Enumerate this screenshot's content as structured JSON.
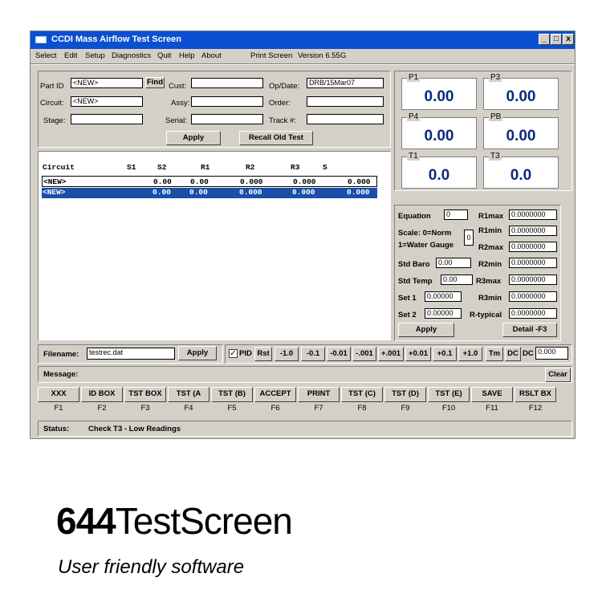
{
  "window": {
    "title": "CCDI Mass Airflow Test Screen",
    "controls": [
      "_",
      "□",
      "x"
    ]
  },
  "menu": [
    "Select",
    "Edit",
    "Setup",
    "Diagnostics",
    "Quit",
    "Help",
    "About",
    "Print Screen",
    "Version 6.55G"
  ],
  "form": {
    "part_id_label": "Part ID",
    "part_id_value": "<NEW>",
    "find_label": "Find",
    "cust_label": "Cust:",
    "cust_value": "",
    "opdate_label": "Op/Date:",
    "opdate_value": "DRB/15Mar07",
    "circuit_label": "Circuit:",
    "circuit_value": "<NEW>",
    "assy_label": "Assy:",
    "assy_value": "",
    "order_label": "Order:",
    "order_value": "",
    "stage_label": "Stage:",
    "stage_value": "",
    "serial_label": "Serial:",
    "serial_value": "",
    "track_label": "Track #:",
    "track_value": "",
    "apply_label": "Apply",
    "recall_label": "Recall Old Test"
  },
  "gauges": {
    "p1": {
      "label": "P1",
      "value": "0.00"
    },
    "p3": {
      "label": "P3",
      "value": "0.00"
    },
    "p4": {
      "label": "P4",
      "value": "0.00"
    },
    "pb": {
      "label": "PB",
      "value": "0.00"
    },
    "t1": {
      "label": "T1",
      "value": "0.0"
    },
    "t3": {
      "label": "T3",
      "value": "0.0"
    }
  },
  "table": {
    "headers": [
      "Circuit",
      "S1",
      "S2",
      "R1",
      "R2",
      "R3",
      "S"
    ],
    "rows": [
      [
        "<NEW>",
        "0.00",
        "0.00",
        "0.000",
        "0.000",
        "0.000"
      ],
      [
        "<NEW>",
        "0.00",
        "0.00",
        "0.000",
        "0.000",
        "0.000"
      ]
    ]
  },
  "settings": {
    "equation_label": "Equation",
    "equation_value": "0",
    "scale_label1": "Scale: 0=Norm",
    "scale_label2": "1=Water Gauge",
    "scale_value": "0",
    "stdbaro_label": "Std Baro",
    "stdbaro_value": "0.00",
    "stdtemp_label": "Std Temp",
    "stdtemp_value": "0.00",
    "set1_label": "Set 1",
    "set1_value": "0.00000",
    "set2_label": "Set 2",
    "set2_value": "0.00000",
    "r1max_label": "R1max",
    "r1max_value": "0.0000000",
    "r1min_label": "R1min",
    "r1min_value": "0.0000000",
    "r2max_label": "R2max",
    "r2max_value": "0.0000000",
    "r2min_label": "R2min",
    "r2min_value": "0.0000000",
    "r3max_label": "R3max",
    "r3max_value": "0.0000000",
    "r3min_label": "R3min",
    "r3min_value": "0.0000000",
    "rtyp_label": "R-typical",
    "rtyp_value": "0.0000000",
    "apply_label": "Apply",
    "detail_label": "Detail -F3"
  },
  "filename": {
    "label": "Filename:",
    "value": "testrec.dat",
    "apply_label": "Apply"
  },
  "pid": {
    "check_label": "PID",
    "checked": true,
    "rst_label": "Rst",
    "steps": [
      "-1.0",
      "-0.1",
      "-0.01",
      "-.001",
      "+.001",
      "+0.01",
      "+0.1",
      "+1.0"
    ],
    "tm_label": "Tm",
    "dc_label": "DC",
    "dc2_label": "DC",
    "dc_value": "0.000"
  },
  "message": {
    "label": "Message:",
    "value": "",
    "clear_label": "Clear"
  },
  "fkeys": [
    {
      "label": "XXX",
      "key": "F1"
    },
    {
      "label": "ID BOX",
      "key": "F2"
    },
    {
      "label": "TST BOX",
      "key": "F3"
    },
    {
      "label": "TST (A",
      "key": "F4"
    },
    {
      "label": "TST (B)",
      "key": "F5"
    },
    {
      "label": "ACCEPT",
      "key": "F6"
    },
    {
      "label": "PRINT",
      "key": "F7"
    },
    {
      "label": "TST (C)",
      "key": "F8"
    },
    {
      "label": "TST (D)",
      "key": "F9"
    },
    {
      "label": "TST (E)",
      "key": "F10"
    },
    {
      "label": "SAVE",
      "key": "F11"
    },
    {
      "label": "RSLT BX",
      "key": "F12"
    }
  ],
  "status": {
    "label": "Status:",
    "value": "Check T3 - Low Readings"
  },
  "caption": {
    "title_bold": "644",
    "title_rest": "TestScreen",
    "subtitle": "User friendly software"
  },
  "colors": {
    "titlebar": "#0a50d0",
    "selection": "#1a4fa8",
    "gauge_text": "#0a2a80",
    "face": "#d4d0c8"
  }
}
